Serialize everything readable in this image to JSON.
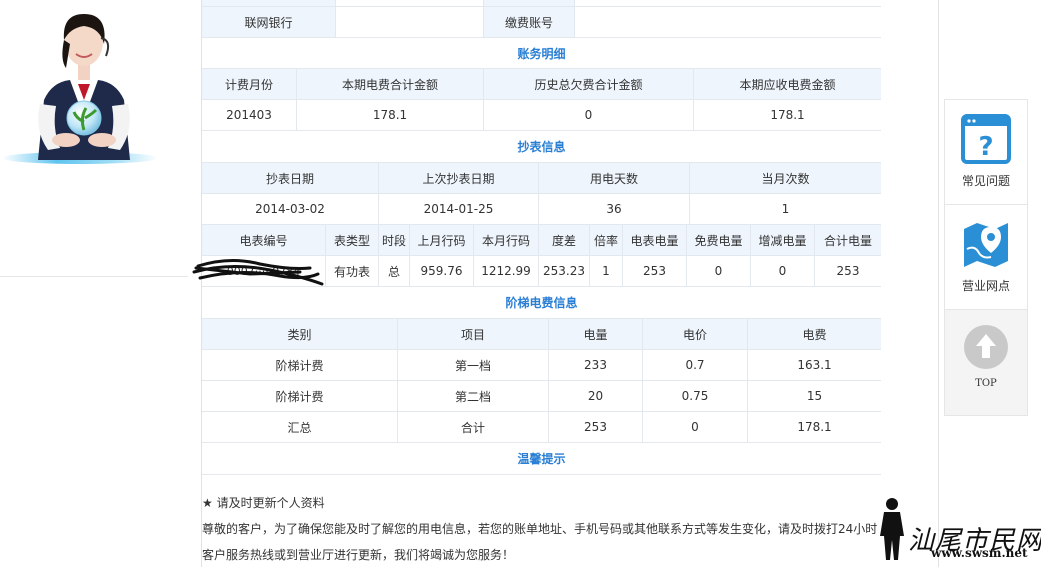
{
  "top_row": {
    "label1": "联网银行",
    "value1": "",
    "label2": "缴费账号",
    "value2": ""
  },
  "billing": {
    "title": "账务明细",
    "headers": [
      "计费月份",
      "本期电费合计金额",
      "历史总欠费合计金额",
      "本期应收电费金额"
    ],
    "row": [
      "201403",
      "178.1",
      "0",
      "178.1"
    ]
  },
  "reading": {
    "title": "抄表信息",
    "headers": [
      "抄表日期",
      "上次抄表日期",
      "用电天数",
      "当月次数"
    ],
    "row": [
      "2014-03-02",
      "2014-01-25",
      "36",
      "1"
    ],
    "meter_headers": [
      "电表编号",
      "表类型",
      "时段",
      "上月行码",
      "本月行码",
      "度差",
      "倍率",
      "电表电量",
      "免费电量",
      "增减电量",
      "合计电量"
    ],
    "meter_row": [
      "0007·····9784",
      "有功表",
      "总",
      "959.76",
      "1212.99",
      "253.23",
      "1",
      "253",
      "0",
      "0",
      "253"
    ]
  },
  "tiered": {
    "title": "阶梯电费信息",
    "headers": [
      "类别",
      "项目",
      "电量",
      "电价",
      "电费"
    ],
    "rows": [
      [
        "阶梯计费",
        "第一档",
        "233",
        "0.7",
        "163.1"
      ],
      [
        "阶梯计费",
        "第二档",
        "20",
        "0.75",
        "15"
      ],
      [
        "汇总",
        "合计",
        "253",
        "0",
        "178.1"
      ]
    ]
  },
  "tips": {
    "title": "温馨提示",
    "line1": "★ 请及时更新个人资料",
    "line2": "尊敬的客户，为了确保您能及时了解您的用电信息，若您的账单地址、手机号码或其他联系方式等发生变化，请及时拨打24小时",
    "line3": "客户服务热线或到营业厅进行更新，我们将竭诚为您服务！"
  },
  "side_panel": {
    "faq": "常见问题",
    "outlets": "营业网点",
    "top": "TOP",
    "icon_color": "#2b8fd6"
  },
  "watermark": {
    "name": "汕尾市民网",
    "url": "www.swsm.net"
  },
  "colors": {
    "section_title": "#2a7fd4",
    "header_bg": "#eef5fc",
    "border": "#e3e8ee"
  }
}
